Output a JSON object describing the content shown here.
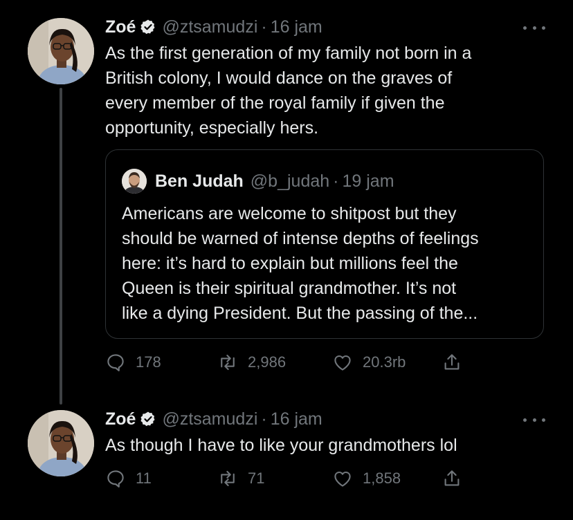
{
  "tweets": [
    {
      "name": "Zoé",
      "handle": "@ztsamudzi",
      "separator": "·",
      "time": "16 jam",
      "text": "As the first generation of my family not born in a\nBritish colony, I would dance on the graves of\nevery member of the royal family if given the\nopportunity, especially hers.",
      "quote": {
        "name": "Ben Judah",
        "handle": "@b_judah",
        "separator": "·",
        "time": "19 jam",
        "text": "Americans are welcome to shitpost but they\nshould be warned of intense depths of feelings\nhere: it’s hard to explain but millions feel the\nQueen is their spiritual grandmother. It’s not\nlike a dying President. But the passing of the..."
      },
      "replies": "178",
      "retweets": "2,986",
      "likes": "20.3rb"
    },
    {
      "name": "Zoé",
      "handle": "@ztsamudzi",
      "separator": "·",
      "time": "16 jam",
      "text": "As though I have to like your grandmothers lol",
      "replies": "11",
      "retweets": "71",
      "likes": "1,858"
    }
  ],
  "icons": {
    "verified": "verified-badge-icon",
    "more": "more-dots-icon",
    "reply": "reply-icon",
    "retweet": "retweet-icon",
    "like": "heart-icon",
    "share": "share-icon"
  },
  "colors": {
    "background": "#000000",
    "text": "#e7e9ea",
    "secondary": "#71767b",
    "border": "#2f3336"
  }
}
